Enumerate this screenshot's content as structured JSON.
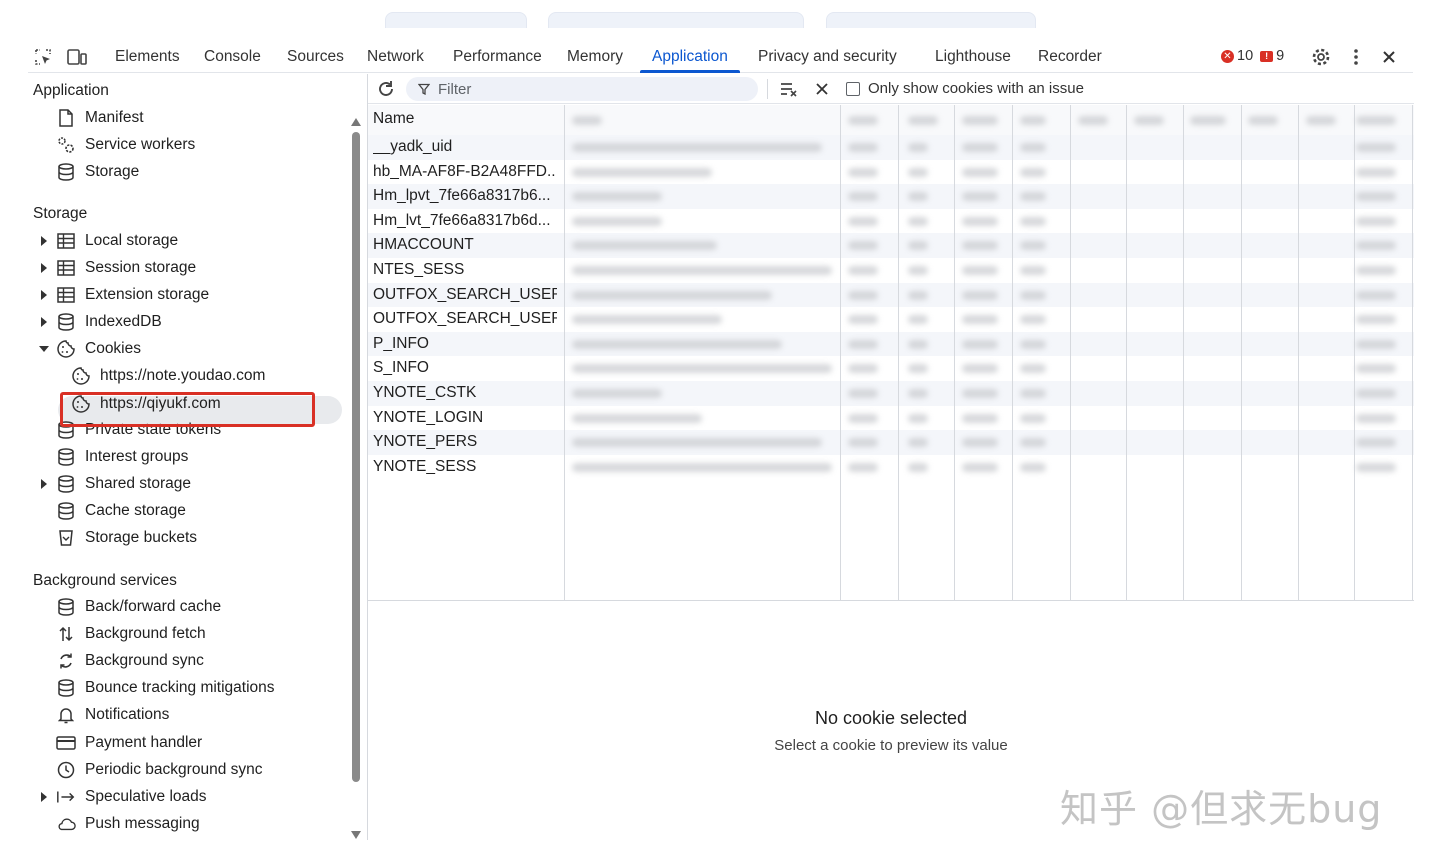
{
  "toolbar": {
    "tabs": [
      "Elements",
      "Console",
      "Sources",
      "Network",
      "Performance",
      "Memory",
      "Application",
      "Privacy and security",
      "Lighthouse",
      "Recorder"
    ],
    "active_tab": "Application",
    "error_count": "10",
    "issue_count": "9"
  },
  "sidebar": {
    "application_title": "Application",
    "application_items": [
      "Manifest",
      "Service workers",
      "Storage"
    ],
    "storage_title": "Storage",
    "storage_items": [
      "Local storage",
      "Session storage",
      "Extension storage",
      "IndexedDB",
      "Cookies"
    ],
    "cookie_children": [
      "https://note.youdao.com",
      "https://qiyukf.com"
    ],
    "storage_items_after": [
      "Private state tokens",
      "Interest groups",
      "Shared storage",
      "Cache storage",
      "Storage buckets"
    ],
    "background_title": "Background services",
    "background_items": [
      "Back/forward cache",
      "Background fetch",
      "Background sync",
      "Bounce tracking mitigations",
      "Notifications",
      "Payment handler",
      "Periodic background sync",
      "Speculative loads",
      "Push messaging"
    ]
  },
  "filter": {
    "placeholder": "Filter",
    "only_issue_label": "Only show cookies with an issue"
  },
  "cookies": {
    "name_header": "Name",
    "names": [
      "__yadk_uid",
      "hb_MA-AF8F-B2A48FFD...",
      "Hm_lpvt_7fe66a8317b6...",
      "Hm_lvt_7fe66a8317b6d...",
      "HMACCOUNT",
      "NTES_SESS",
      "OUTFOX_SEARCH_USER...",
      "OUTFOX_SEARCH_USER...",
      "P_INFO",
      "S_INFO",
      "YNOTE_CSTK",
      "YNOTE_LOGIN",
      "YNOTE_PERS",
      "YNOTE_SESS"
    ]
  },
  "preview": {
    "title": "No cookie selected",
    "subtitle": "Select a cookie to preview its value"
  },
  "watermark": "知乎 @但求无bug"
}
